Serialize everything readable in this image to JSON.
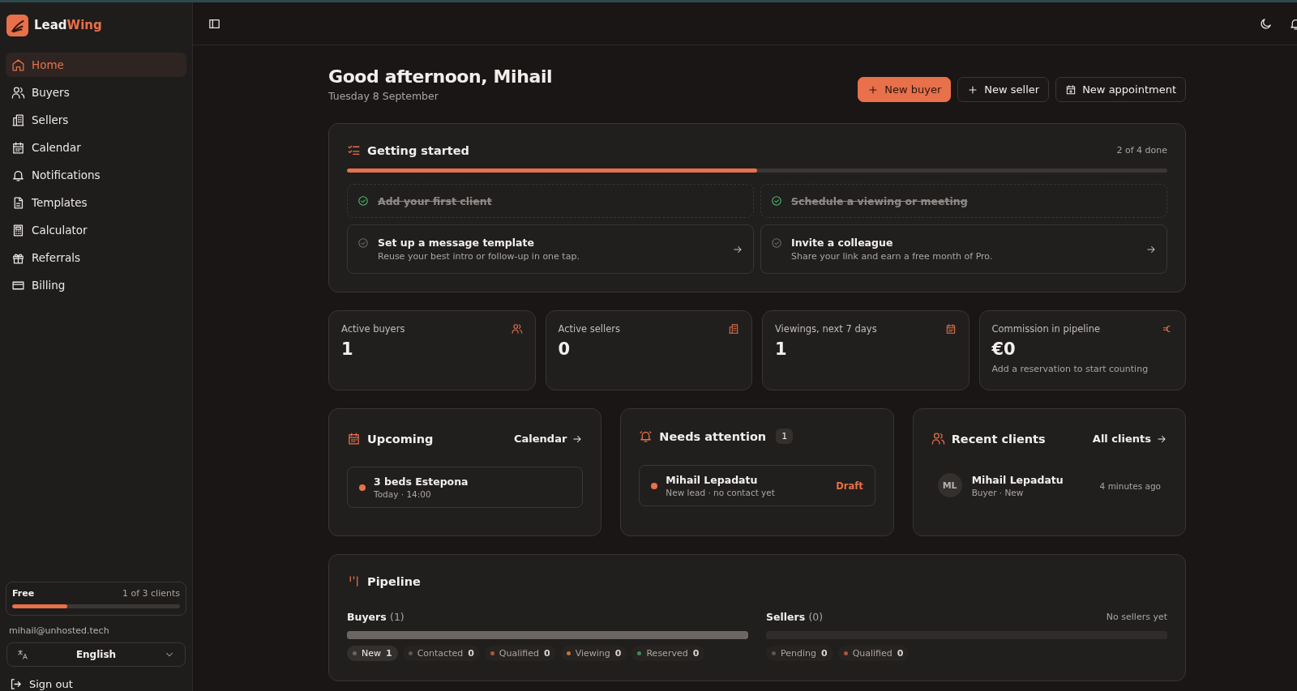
{
  "brand": {
    "main": "Lead",
    "accent": "Wing"
  },
  "nav": [
    {
      "label": "Home",
      "selected": true
    },
    {
      "label": "Buyers",
      "selected": false
    },
    {
      "label": "Sellers",
      "selected": false
    },
    {
      "label": "Calendar",
      "selected": false
    },
    {
      "label": "Notifications",
      "selected": false
    },
    {
      "label": "Templates",
      "selected": false
    },
    {
      "label": "Calculator",
      "selected": false
    },
    {
      "label": "Referrals",
      "selected": false
    },
    {
      "label": "Billing",
      "selected": false
    }
  ],
  "plan": {
    "name": "Free",
    "usage": "1 of 3 clients",
    "level": 0.33
  },
  "email": "mihail@unhosted.tech",
  "language": "English",
  "sign_out": "Sign out",
  "greeting": {
    "title": "Good afternoon, Mihail",
    "date": "Tuesday 8 September"
  },
  "actions": [
    {
      "label": "New buyer",
      "kind": "primary"
    },
    {
      "label": "New seller",
      "kind": "plus"
    },
    {
      "label": "New appointment",
      "kind": "calendar"
    }
  ],
  "getting_started": {
    "title": "Getting started",
    "progress": "2 of 4 done",
    "level": 0.5,
    "tasks": [
      {
        "title": "Add your first client",
        "done": true
      },
      {
        "title": "Schedule a viewing or meeting",
        "done": true
      },
      {
        "title": "Set up a message template",
        "description": "Reuse your best intro or follow-up in one tap.",
        "done": false
      },
      {
        "title": "Invite a colleague",
        "description": "Share your link and earn a free month of Pro.",
        "done": false
      }
    ]
  },
  "stats": [
    {
      "label": "Active buyers",
      "value": "1"
    },
    {
      "label": "Active sellers",
      "value": "0"
    },
    {
      "label": "Viewings, next 7 days",
      "value": "1"
    },
    {
      "label": "Commission in pipeline",
      "value": "€0",
      "note": "Add a reservation to start counting"
    }
  ],
  "upcoming": {
    "title": "Upcoming",
    "link": "Calendar",
    "items": [
      {
        "title": "3 beds Estepona",
        "meta": "Today · 14:00",
        "color": "#e8704a"
      }
    ]
  },
  "attention": {
    "title": "Needs attention",
    "count": "1",
    "items": [
      {
        "name": "Mihail Lepadatu",
        "meta": "New lead · no contact yet",
        "status": "Draft",
        "color": "#e8704a"
      }
    ]
  },
  "recent": {
    "title": "Recent clients",
    "link": "All clients",
    "items": [
      {
        "initials": "ML",
        "name": "Mihail Lepadatu",
        "meta": "Buyer · New",
        "time": "4 minutes ago"
      }
    ]
  },
  "pipeline": {
    "title": "Pipeline",
    "groups": [
      {
        "label": "Buyers",
        "count": "(1)",
        "level": 1,
        "stages": [
          {
            "label": "New",
            "count": "1",
            "color": "#6b6664",
            "selected": true
          },
          {
            "label": "Contacted",
            "count": "0",
            "color": "#5a5655",
            "selected": false
          },
          {
            "label": "Qualified",
            "count": "0",
            "color": "#b0553a",
            "selected": false
          },
          {
            "label": "Viewing",
            "count": "0",
            "color": "#b9773a",
            "selected": false
          },
          {
            "label": "Reserved",
            "count": "0",
            "color": "#3f8a5a",
            "selected": false
          }
        ]
      },
      {
        "label": "Sellers",
        "count": "(0)",
        "note": "No sellers yet",
        "level": 0,
        "stages": [
          {
            "label": "Pending",
            "count": "0",
            "color": "#5a5655",
            "selected": false
          },
          {
            "label": "Qualified",
            "count": "0",
            "color": "#b0553a",
            "selected": false
          }
        ]
      }
    ]
  }
}
